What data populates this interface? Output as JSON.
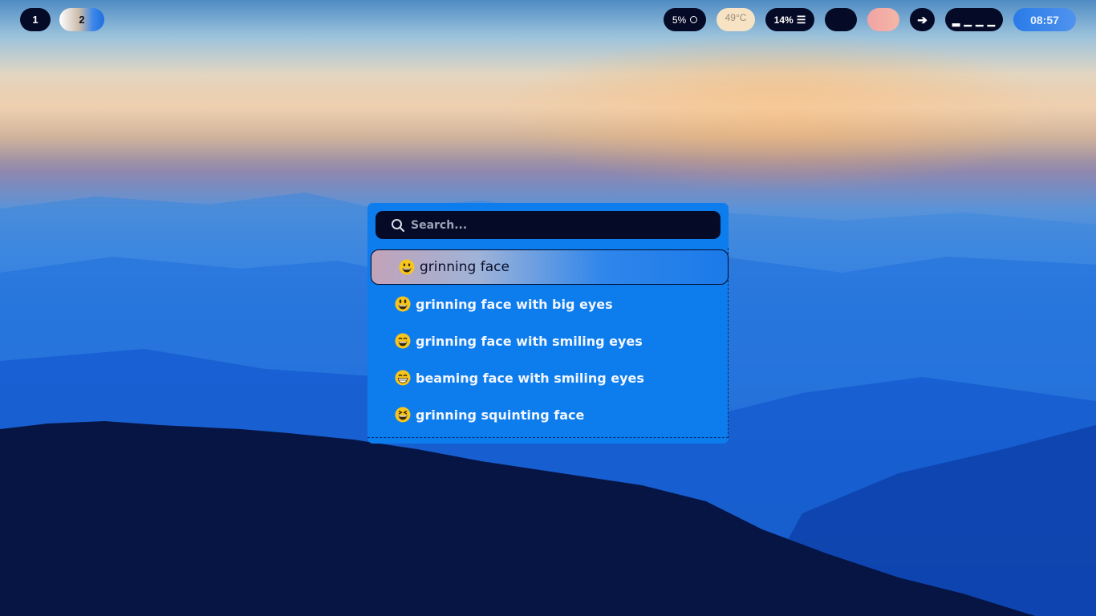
{
  "topbar": {
    "workspaces": [
      "1",
      "2"
    ],
    "cpu": "5%",
    "temperature": "49°C",
    "memory": "14%",
    "clock": "08:57",
    "dashes": "▂ ▁ ▁ ▁",
    "arrow": "➔",
    "menu_icon": "☰"
  },
  "launcher": {
    "search_placeholder": "Search...",
    "results": [
      {
        "emoji": "grinning-face",
        "label": "grinning face"
      },
      {
        "emoji": "grinning-face-with-big-eyes",
        "label": "grinning face with big eyes"
      },
      {
        "emoji": "grinning-face-with-smiling-eyes",
        "label": "grinning face with smiling eyes"
      },
      {
        "emoji": "beaming-face-with-smiling-eyes",
        "label": "beaming face with smiling eyes"
      },
      {
        "emoji": "grinning-squinting-face",
        "label": "grinning squinting face"
      }
    ]
  },
  "colors": {
    "bar_dark": "#050a26",
    "launcher_bg": "#0d7ded",
    "clock_bg": "#2a7be8",
    "temp_bg": "#f7e3c4",
    "emoji_yellow": "#f8c51b"
  }
}
